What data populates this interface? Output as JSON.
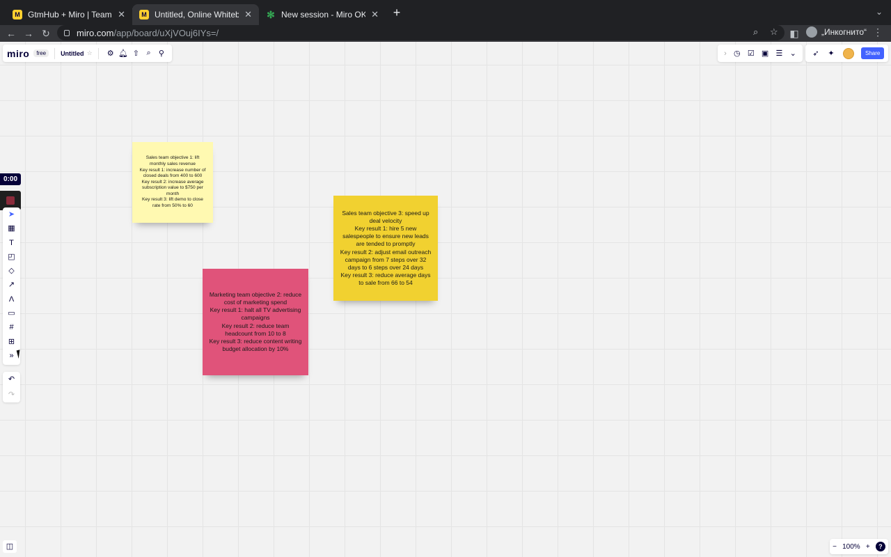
{
  "browser": {
    "tabs": [
      {
        "title": "GtmHub + Miro | Team Collabo",
        "icon": "miro-icon",
        "active": false
      },
      {
        "title": "Untitled, Online Whiteboard for",
        "icon": "miro-icon",
        "active": true
      },
      {
        "title": "New session - Miro OKRs",
        "icon": "okr-icon",
        "active": false
      }
    ],
    "url_domain": "miro.com",
    "url_path": "/app/board/uXjVOuj6IYs=/",
    "profile_label": "„Инкогнито“"
  },
  "miro": {
    "logo": "miro",
    "plan": "free",
    "board_name": "Untitled",
    "share_label": "Share",
    "timer": "0:00",
    "zoom_level": "100%",
    "zoom_minus": "−",
    "zoom_plus": "+",
    "help": "?"
  },
  "stickies": [
    {
      "color": "#fff9b1",
      "text": "Sales team objective 1: lift monthly sales revenue\nKey result 1: increase number of closed deals from 400 to 600\nKey result 2: increase average subscription value to $750 per month\nKey result 3: lift demo to close rate from 50% to 60"
    },
    {
      "color": "#f1d130",
      "text": "Sales team objective 3: speed up deal velocity\nKey result 1: hire 5 new salespeople to ensure new leads are tended to promptly\nKey result 2: adjust email outreach campaign from 7 steps over 32 days to 6 steps over 24 days\nKey result 3: reduce average days to sale from 66 to 54"
    },
    {
      "color": "#e0537a",
      "text": "Marketing team objective 2: reduce cost of marketing spend\nKey result 1: halt all TV advertising campaigns\nKey result 2: reduce team headcount from 10 to 8\nKey result 3: reduce content writing budget allocation by 10%"
    }
  ]
}
